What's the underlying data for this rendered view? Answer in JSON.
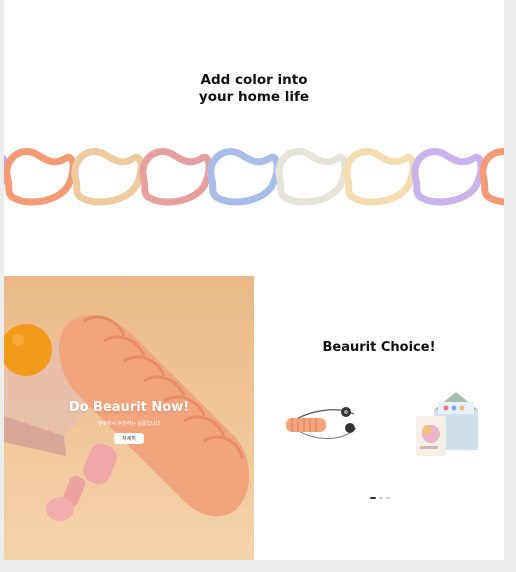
{
  "headline": {
    "line1": "Add color into",
    "line2": "your home life"
  },
  "ring_colors": [
    "#b9a9e6",
    "#f39a76",
    "#eecb9f",
    "#e6a0a0",
    "#a9bde9",
    "#e6e3d9",
    "#f4ddb1",
    "#c8b4ea",
    "#f39a76"
  ],
  "promo": {
    "title": "Do Beaurit Now!",
    "subtitle": "뷰릿에서 추천하는 상품입니다",
    "button_label": "자세히"
  },
  "choice": {
    "title": "Beaurit Choice!",
    "products": [
      {
        "icon": "resistance-band-product-image"
      },
      {
        "icon": "packaged-product-set-image"
      }
    ],
    "pagination_total": 3,
    "pagination_active": 1
  }
}
